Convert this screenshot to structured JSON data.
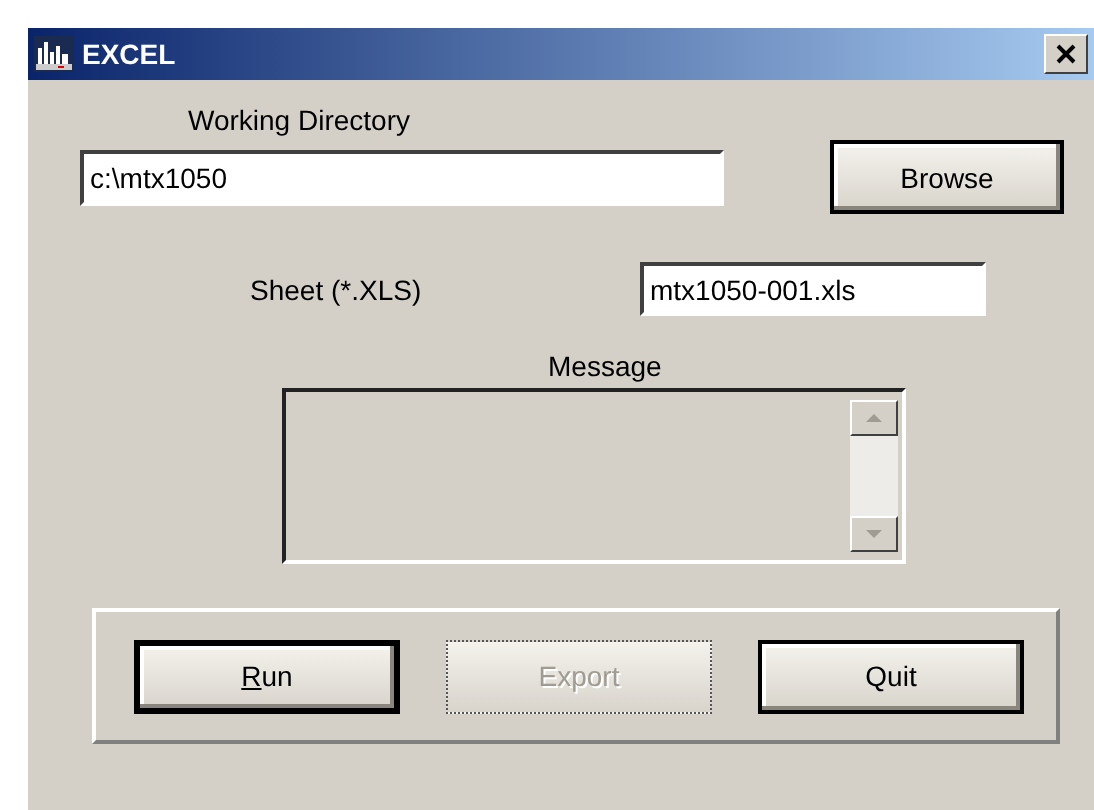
{
  "window": {
    "title": "EXCEL"
  },
  "working_directory": {
    "label": "Working Directory",
    "value": "c:\\mtx1050"
  },
  "browse_button": {
    "label": "Browse"
  },
  "sheet": {
    "label": "Sheet (*.XLS)",
    "value": "mtx1050-001.xls"
  },
  "message": {
    "label": "Message"
  },
  "buttons": [
    {
      "label": "Run",
      "underline_first": true,
      "default": true,
      "disabled": false
    },
    {
      "label": "Export",
      "underline_first": false,
      "default": false,
      "disabled": true
    },
    {
      "label": "Quit",
      "underline_first": false,
      "default": false,
      "disabled": false
    }
  ]
}
